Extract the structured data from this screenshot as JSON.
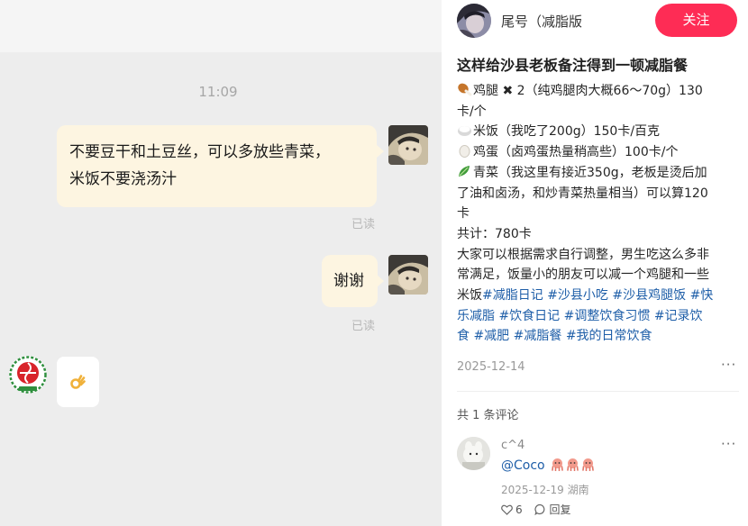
{
  "chat": {
    "time": "11:09",
    "message_1_lines": [
      "不要豆干和土豆丝，可以多放些青菜，",
      "米饭不要浇汤汁"
    ],
    "read_1": "已读",
    "message_2": "谢谢",
    "read_2": "已读",
    "reply_emoji": "ok-hand-emoji"
  },
  "post": {
    "author": {
      "name": "尾号（减脂版"
    },
    "follow_label": "关注",
    "title": "这样给沙县老板备注得到一顿减脂餐",
    "body_lines": [
      {
        "icon": "chicken-leg-icon",
        "text": "鸡腿 ✖ 2（纯鸡腿肉大概66～70g）130"
      },
      {
        "text": "卡/个"
      },
      {
        "icon": "rice-icon",
        "text": "米饭（我吃了200g）150卡/百克"
      },
      {
        "icon": "egg-icon",
        "text": "鸡蛋（卤鸡蛋热量稍高些）100卡/个"
      },
      {
        "icon": "leafy-greens-icon",
        "text": "青菜（我这里有接近350g，老板是烫后加"
      },
      {
        "text": "了油和卤汤，和炒青菜热量相当）可以算120"
      },
      {
        "text": "卡"
      },
      {
        "text": "共计：780卡"
      },
      {
        "text": "大家可以根据需求自行调整，男生吃这么多非"
      },
      {
        "text": "常满足，饭量小的朋友可以减一个鸡腿和一些"
      },
      {
        "text": "米饭",
        "tags": [
          "#减脂日记",
          "#沙县小吃",
          "#沙县鸡腿饭",
          "#快"
        ]
      },
      {
        "tags": [
          "乐减脂",
          "#饮食日记",
          "#调整饮食习惯",
          "#记录饮"
        ]
      },
      {
        "tags": [
          "食",
          "#减肥",
          "#减脂餐",
          "#我的日常饮食"
        ]
      }
    ],
    "date": "2025-12-14",
    "more_label": "···",
    "comments_count": "共 1 条评论",
    "comment": {
      "user": "c^4",
      "text": "@Coco",
      "reaction_icons": [
        "octopus-icon",
        "octopus-icon",
        "octopus-icon"
      ],
      "date": "2025-12-19",
      "location": "湖南",
      "likes": "6",
      "reply_label": "回复",
      "more_label": "···"
    }
  },
  "colors": {
    "accent": "#fe2c55",
    "hashtag": "#1e5ea8",
    "chat_bubble": "#fdf5e1",
    "chat_background": "#ededed"
  }
}
